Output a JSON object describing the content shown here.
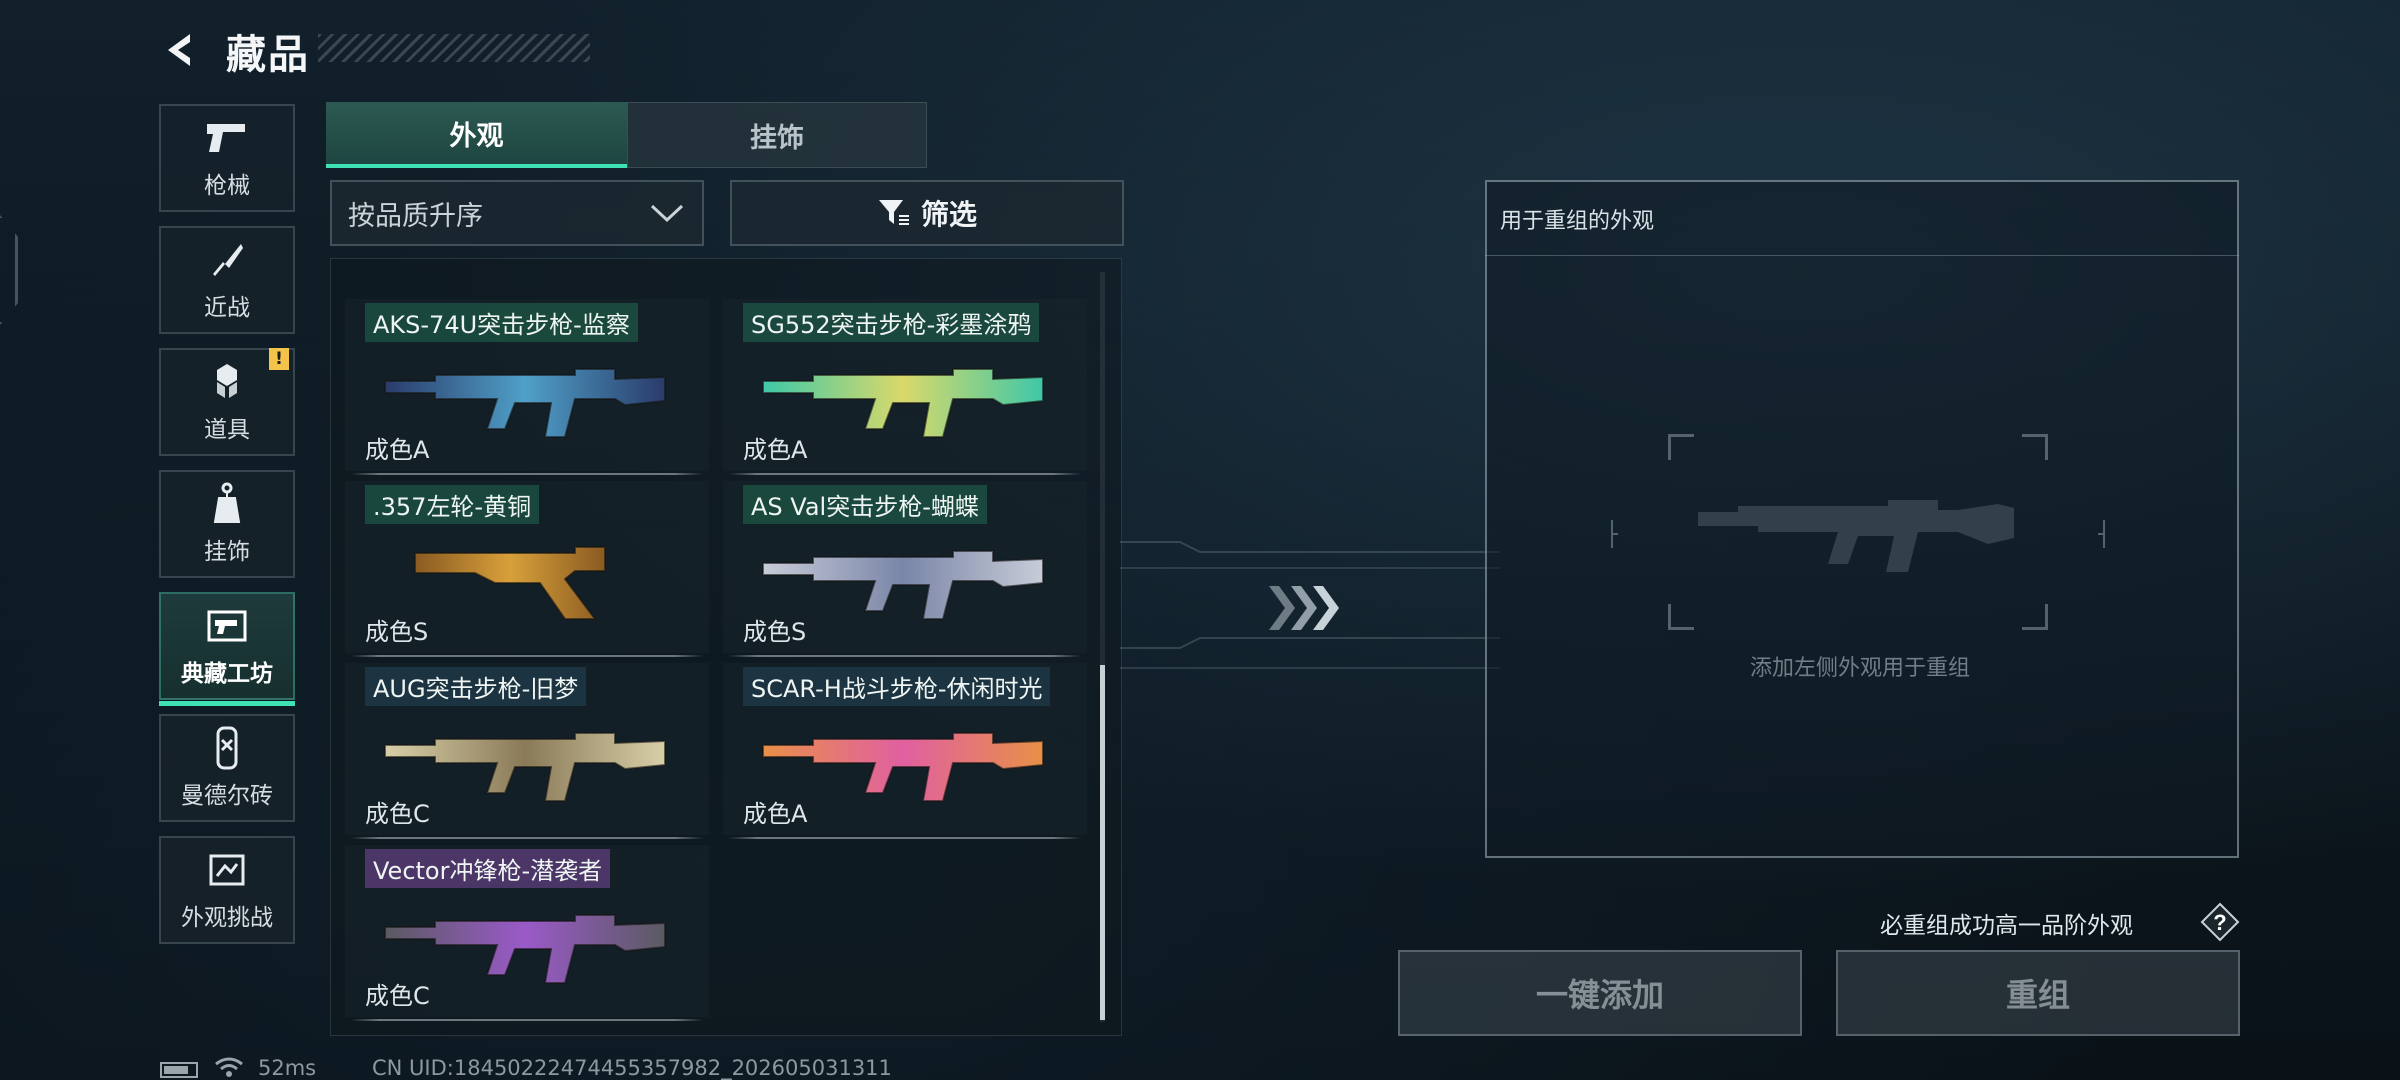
{
  "header": {
    "title": "藏品"
  },
  "sidebar": {
    "items": [
      {
        "label": "枪械",
        "icon": "pistol-icon"
      },
      {
        "label": "近战",
        "icon": "knife-icon"
      },
      {
        "label": "道具",
        "icon": "items-icon",
        "badge": "!"
      },
      {
        "label": "挂饰",
        "icon": "charm-icon"
      },
      {
        "label": "典藏工坊",
        "icon": "workshop-icon",
        "active": true
      },
      {
        "label": "曼德尔砖",
        "icon": "mandel-brick-icon"
      },
      {
        "label": "外观挑战",
        "icon": "challenge-icon"
      }
    ]
  },
  "tabs": [
    {
      "label": "外观",
      "active": true
    },
    {
      "label": "挂饰",
      "active": false
    }
  ],
  "sort": {
    "value": "按品质升序"
  },
  "filter": {
    "label": "筛选"
  },
  "skins": [
    {
      "name": "AKS-74U突击步枪-监察",
      "grade": "成色A",
      "colors": [
        "#2a3b6a",
        "#4fa0c8"
      ]
    },
    {
      "name": "SG552突击步枪-彩墨涂鸦",
      "grade": "成色A",
      "colors": [
        "#3ec8a8",
        "#d9d96a"
      ]
    },
    {
      "name": ".357左轮-黄铜",
      "grade": "成色S",
      "colors": [
        "#8a5a22",
        "#d8a03a"
      ]
    },
    {
      "name": "AS Val突击步枪-蝴蝶",
      "grade": "成色S",
      "colors": [
        "#c8ccd8",
        "#7a86a8"
      ]
    },
    {
      "name": "AUG突击步枪-旧梦",
      "grade": "成色C",
      "colors": [
        "#d8cfa8",
        "#8a7a58"
      ]
    },
    {
      "name": "SCAR-H战斗步枪-休闲时光",
      "grade": "成色A",
      "colors": [
        "#e89048",
        "#e060a0"
      ]
    },
    {
      "name": "Vector冲锋枪-潜袭者",
      "grade": "成色C",
      "colors": [
        "#5a5a62",
        "#9a5ac8"
      ]
    }
  ],
  "recombine": {
    "title": "用于重组的外观",
    "hint": "添加左侧外观用于重组",
    "guarantee": "必重组成功高一品阶外观",
    "help": "?",
    "add_all_label": "一键添加",
    "recombine_label": "重组"
  },
  "status": {
    "ping": "52ms",
    "uid": "CN UID:18450222474455357982_202605031311"
  }
}
